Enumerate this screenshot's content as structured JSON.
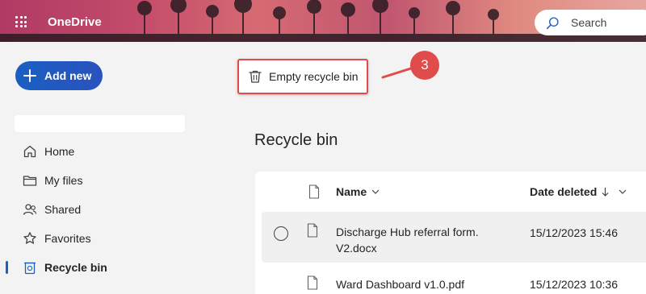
{
  "header": {
    "app_name": "OneDrive",
    "search_placeholder": "Search"
  },
  "sidebar": {
    "add_new_label": "Add new",
    "items": [
      {
        "label": "Home",
        "icon": "home-icon"
      },
      {
        "label": "My files",
        "icon": "folder-icon"
      },
      {
        "label": "Shared",
        "icon": "people-icon"
      },
      {
        "label": "Favorites",
        "icon": "star-icon"
      },
      {
        "label": "Recycle bin",
        "icon": "recycle-bin-icon",
        "active": true
      }
    ]
  },
  "toolbar": {
    "empty_recycle_bin_label": "Empty recycle bin",
    "callout_number": "3"
  },
  "main": {
    "title": "Recycle bin",
    "columns": {
      "name": "Name",
      "date_deleted": "Date deleted"
    },
    "rows": [
      {
        "name_line1": "Discharge Hub referral form.",
        "name_line2": "V2.docx",
        "date": "15/12/2023 15:46"
      },
      {
        "name_line1": "Ward Dashboard v1.0.pdf",
        "name_line2": "",
        "date": "15/12/2023 10:36"
      }
    ]
  },
  "colors": {
    "accent": "#1a5fc1",
    "callout": "#e04b4b"
  }
}
